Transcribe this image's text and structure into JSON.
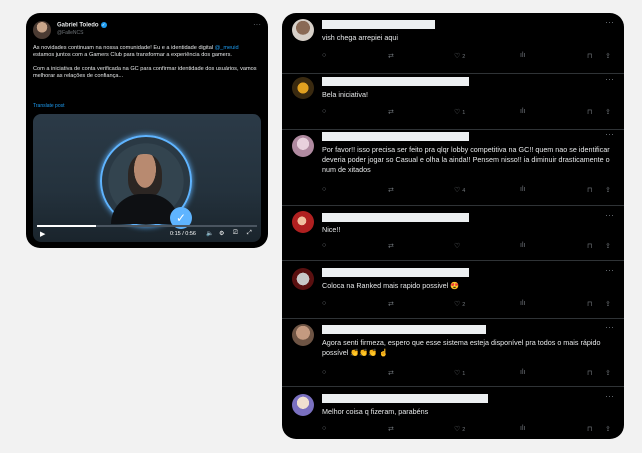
{
  "post": {
    "author_name": "Gabriel Toledo",
    "author_handle": "@FalleNCS",
    "more_icon": "more-icon",
    "text_paragraph_1_before": "As novidades continuam na nossa comunidade! Eu e a identidade digital ",
    "mention": "@_meuid",
    "text_paragraph_1_after": " estamos juntos com a Gamers Club para transformar a experiência dos gamers.",
    "text_paragraph_2": "Com a iniciativa de conta verificada na GC para confirmar identidade dos usuários, vamos melhorar as relações de confiança...",
    "translate_label": "Translate post",
    "video": {
      "time": "0:15 / 0:56",
      "progress": 0.27
    }
  },
  "replies": [
    {
      "text": "vish chega arrepiei aqui",
      "likes": "2",
      "avatar_color": "#d7d0c8"
    },
    {
      "text": "Bela iniciativa!",
      "likes": "",
      "avatar_color": "#e0a020"
    },
    {
      "text": "",
      "likes": "1",
      "avatar_color": "#6b5a4d"
    },
    {
      "text": "Por favor!! isso precisa ser feito pra qlqr lobby competitiva na GC!! quem nao se identificar deveria poder jogar so Casual e olha la ainda!! Pensem nisso!! ia diminuir drasticamente o num de xitados",
      "likes": "4",
      "avatar_color": "#c9a0b4"
    },
    {
      "text": "Nice!!",
      "likes": "",
      "avatar_color": "#b02020"
    },
    {
      "text": "Coloca na Ranked mais rapido possivel 😍",
      "likes": "2",
      "avatar_color": "#c8c8c8"
    },
    {
      "text": "Agora senti firmeza, espero que esse sistema esteja disponível pra todos o mais rápido possível 👏👏👏 ☝",
      "likes": "1",
      "avatar_color": "#8a6a55"
    },
    {
      "text": "Melhor coisa q fizeram, parabéns",
      "likes": "2",
      "avatar_color": "#7a70c0"
    }
  ]
}
